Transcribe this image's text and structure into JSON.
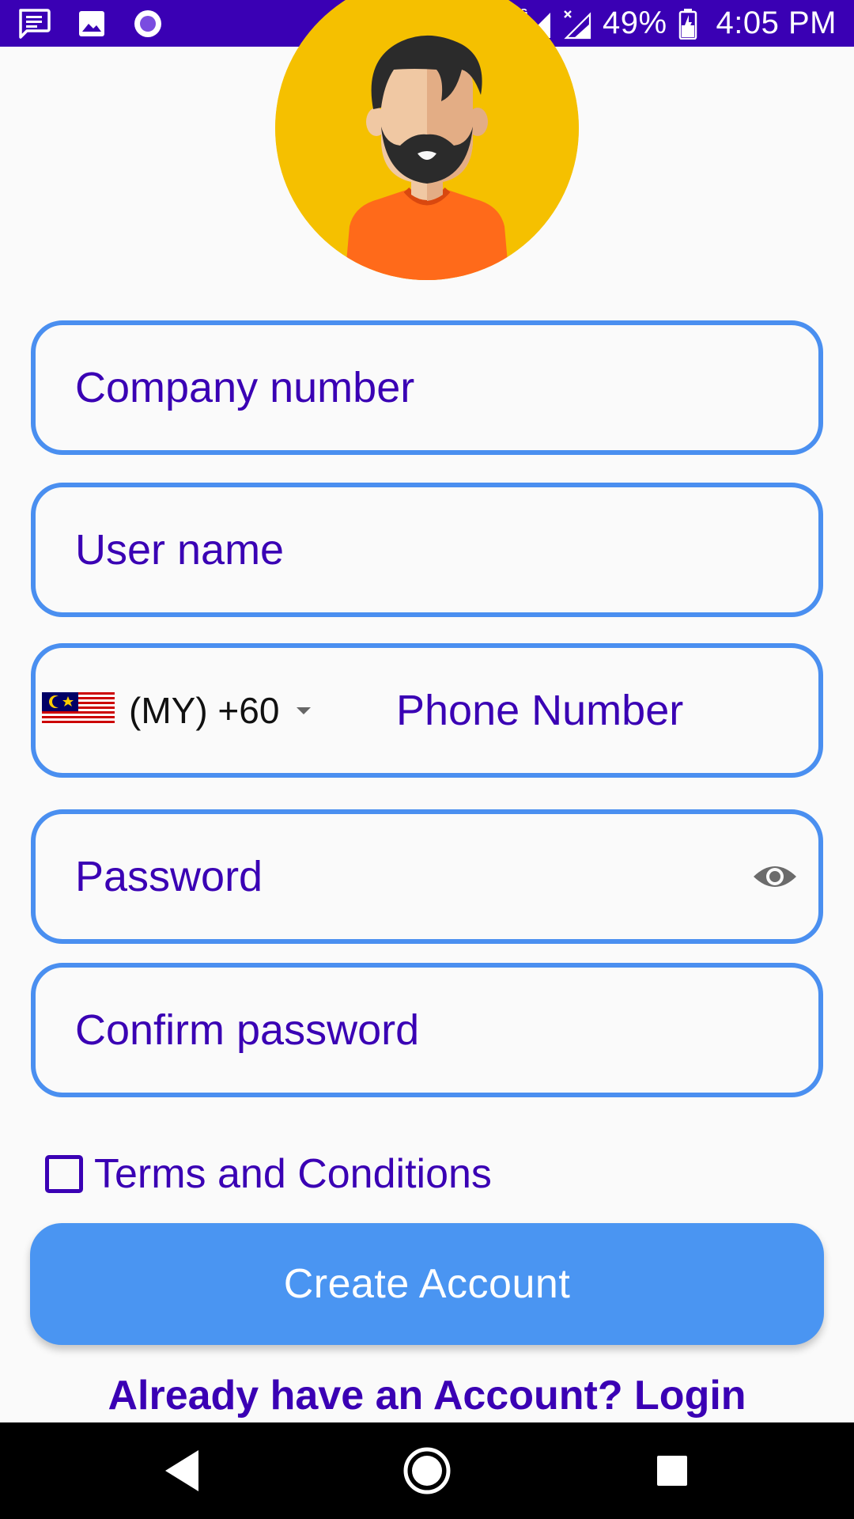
{
  "status_bar": {
    "icons_left": [
      "message-icon",
      "image-icon",
      "circle-app-icon"
    ],
    "icons_right": [
      "bluetooth-icon",
      "alarm-icon",
      "signal-4g-icon",
      "signal-no-data-icon",
      "battery-icon"
    ],
    "network_label": "4G",
    "battery": "49%",
    "time": "4:05 PM"
  },
  "avatar": {
    "icon": "user-avatar-icon",
    "colors": {
      "background": "#f5c000",
      "shirt": "#ff6a1a",
      "hair": "#2b2b2b",
      "skin": "#f0c8a3"
    }
  },
  "form": {
    "company_number": {
      "placeholder": "Company number",
      "value": ""
    },
    "user_name": {
      "placeholder": "User name",
      "value": ""
    },
    "phone": {
      "country_code": "(MY) +60",
      "flag_icon": "malaysia-flag-icon",
      "placeholder": "Phone Number",
      "value": ""
    },
    "password": {
      "placeholder": "Password",
      "value": "",
      "toggle_icon": "eye-icon"
    },
    "confirm_password": {
      "placeholder": "Confirm password",
      "value": ""
    }
  },
  "terms": {
    "label": "Terms and Conditions",
    "checked": false
  },
  "create_button": {
    "label": "Create Account"
  },
  "login_link": {
    "label": "Already have an Account? Login"
  },
  "nav_bar": {
    "icons": [
      "back-icon",
      "home-icon",
      "recents-icon"
    ]
  },
  "colors": {
    "status_bar": "#3a00b4",
    "primary_text": "#3a00b4",
    "field_border": "#4a8ff0",
    "button": "#4a95f2",
    "background": "#fafafa"
  }
}
